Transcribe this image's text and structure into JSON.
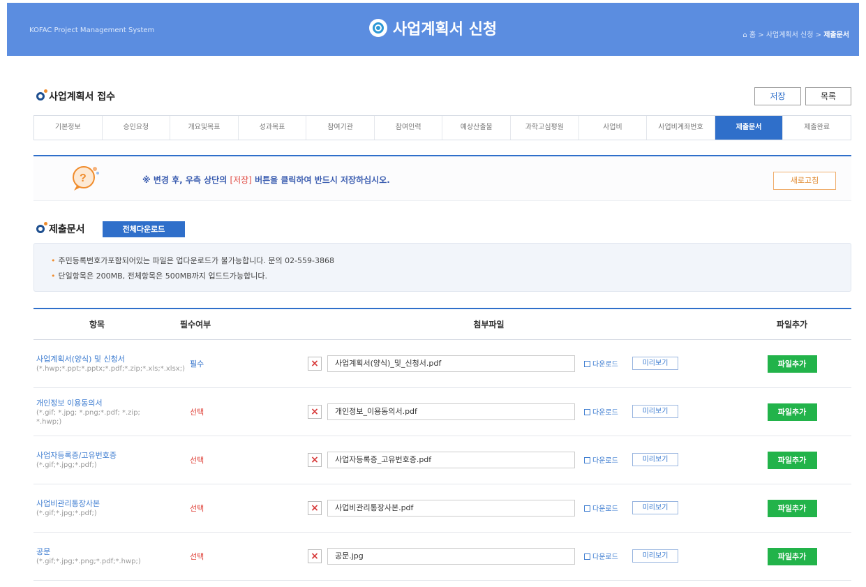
{
  "header": {
    "system_name": "KOFAC Project Management System",
    "title": "사업계획서 신청",
    "breadcrumb": {
      "home": "홈",
      "parent": "사업계획서 신청",
      "current": "제출문서",
      "sep": ">"
    }
  },
  "section1": {
    "title": "사업계획서 접수",
    "save_label": "저장",
    "list_label": "목록"
  },
  "tabs": [
    {
      "label": "기본정보"
    },
    {
      "label": "승인요청"
    },
    {
      "label": "개요및목표"
    },
    {
      "label": "성과목표"
    },
    {
      "label": "참여기관"
    },
    {
      "label": "참여인력"
    },
    {
      "label": "예상산출물"
    },
    {
      "label": "과학고심평원"
    },
    {
      "label": "사업비"
    },
    {
      "label": "사업비계좌번호"
    },
    {
      "label": "제출문서",
      "active": true
    },
    {
      "label": "제출완료"
    }
  ],
  "notice": {
    "text_before": "※ 변경 후, 우측 상단의 ",
    "highlight": "[저장]",
    "text_after": " 버튼을 클릭하여 반드시 저장하십시오.",
    "refresh_label": "새로고침"
  },
  "section2": {
    "title": "제출문서",
    "download_all_label": "전체다운로드"
  },
  "info": {
    "line1": "주민등록번호가포함되어있는 파일은 업다운로드가 불가능합니다. 문의 02-559-3868",
    "line2": "단일항목은 200MB, 전체항목은 500MB까지 업드드가능합니다."
  },
  "table": {
    "headers": {
      "item": "항목",
      "required": "필수여부",
      "file": "첨부파일",
      "add": "파일추가"
    },
    "download_label": "다운로드",
    "preview_label": "미리보기",
    "add_label": "파일추가",
    "rows": [
      {
        "name": "사업계획서(양식) 및 신청서",
        "ext": "(*.hwp;*.ppt;*.pptx;*.pdf;*.zip;*.xls;*.xlsx;)",
        "required": "필수",
        "file": "사업계획서(양식)_및_신청서.pdf"
      },
      {
        "name": "개인정보 이용동의서",
        "ext": "(*.gif; *.jpg; *.png;*.pdf; *.zip; *.hwp;)",
        "required": "선택",
        "file": "개인정보_이용동의서.pdf"
      },
      {
        "name": "사업자등록증/고유번호증",
        "ext": "(*.gif;*.jpg;*.pdf;)",
        "required": "선택",
        "file": "사업자등록증_고유번호증.pdf"
      },
      {
        "name": "사업비관리통장사본",
        "ext": "(*.gif;*.jpg;*.pdf;)",
        "required": "선택",
        "file": "사업비관리통장사본.pdf"
      },
      {
        "name": "공문",
        "ext": "(*.gif;*.jpg;*.png;*.pdf;*.hwp;)",
        "required": "선택",
        "file": "공문.jpg"
      }
    ]
  },
  "colors": {
    "header_bg": "#5b8de0",
    "accent": "#2f6fca",
    "required": "#2f6fca",
    "optional": "#e0473f",
    "add_button": "#22b34a"
  }
}
